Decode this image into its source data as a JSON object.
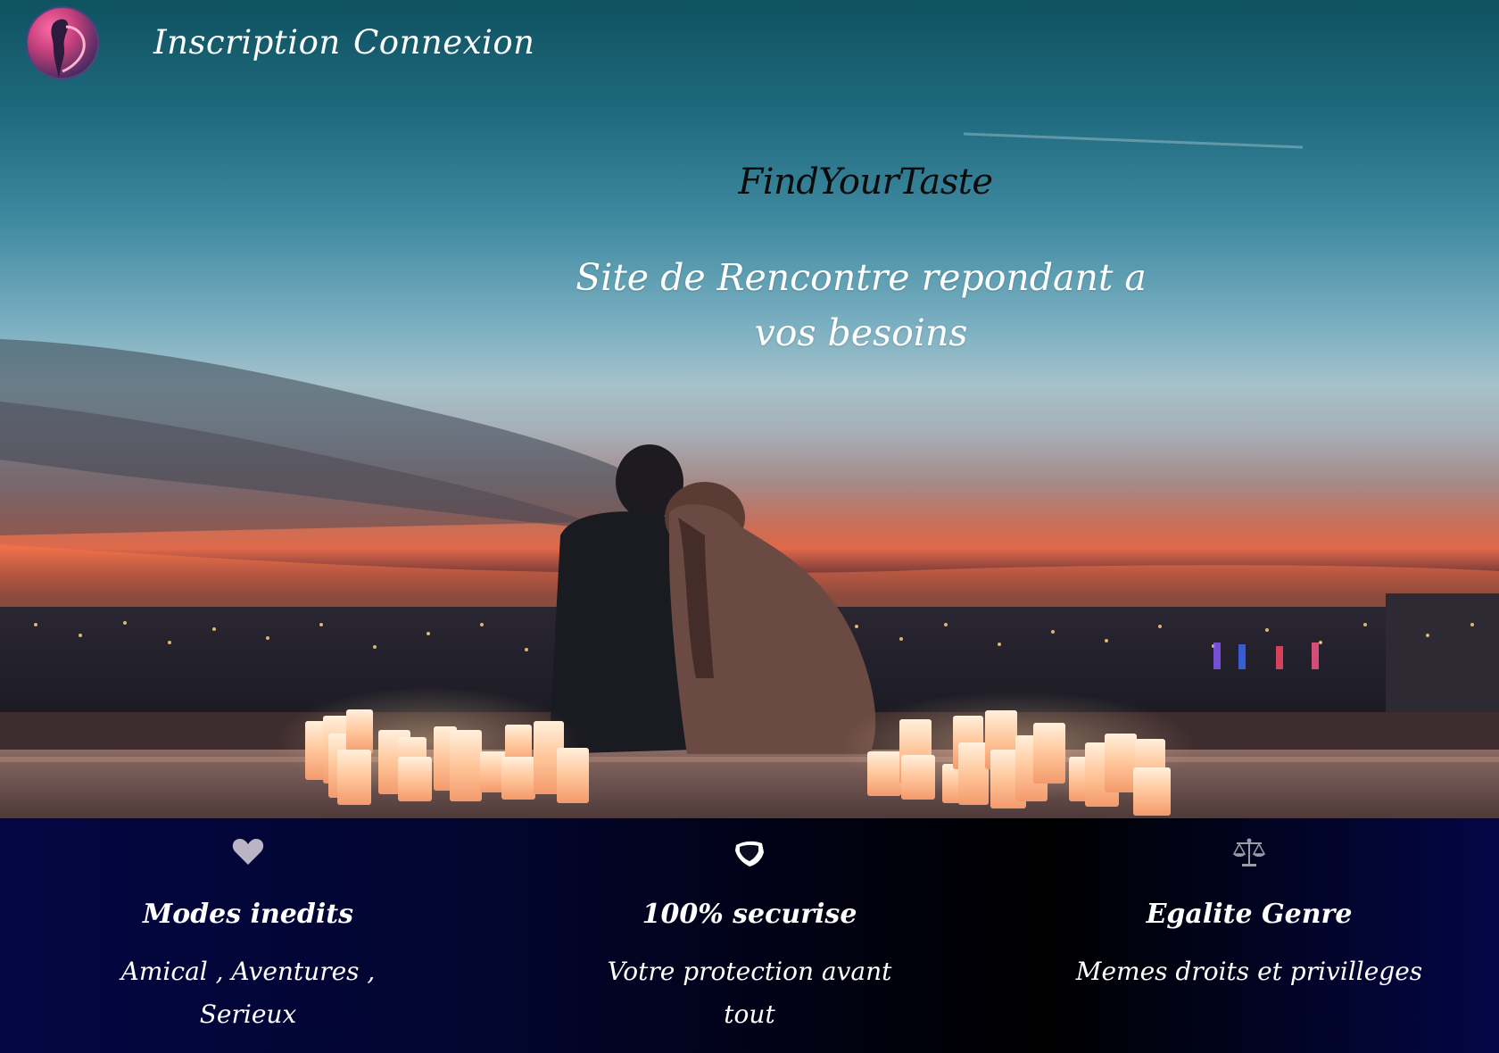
{
  "nav": {
    "inscription_label": "Inscription",
    "connexion_label": "Connexion"
  },
  "hero": {
    "brand": "FindYourTaste",
    "tagline": "Site de Rencontre repondant a vos besoins"
  },
  "features": [
    {
      "icon": "heart-icon",
      "title": "Modes inedits",
      "desc": "Amical , Aventures , Serieux"
    },
    {
      "icon": "shield-icon",
      "title": "100% securise",
      "desc": "Votre protection avant tout"
    },
    {
      "icon": "balance-scale-icon",
      "title": "Egalite Genre",
      "desc": "Memes droits et privilleges"
    }
  ],
  "colors": {
    "features_bg_left": "#030643",
    "features_bg_center": "#000000",
    "features_bg_right": "#030645",
    "logo_pink": "#d24a86",
    "logo_purple": "#4a3570",
    "icon_gray": "#b4b4c0"
  }
}
